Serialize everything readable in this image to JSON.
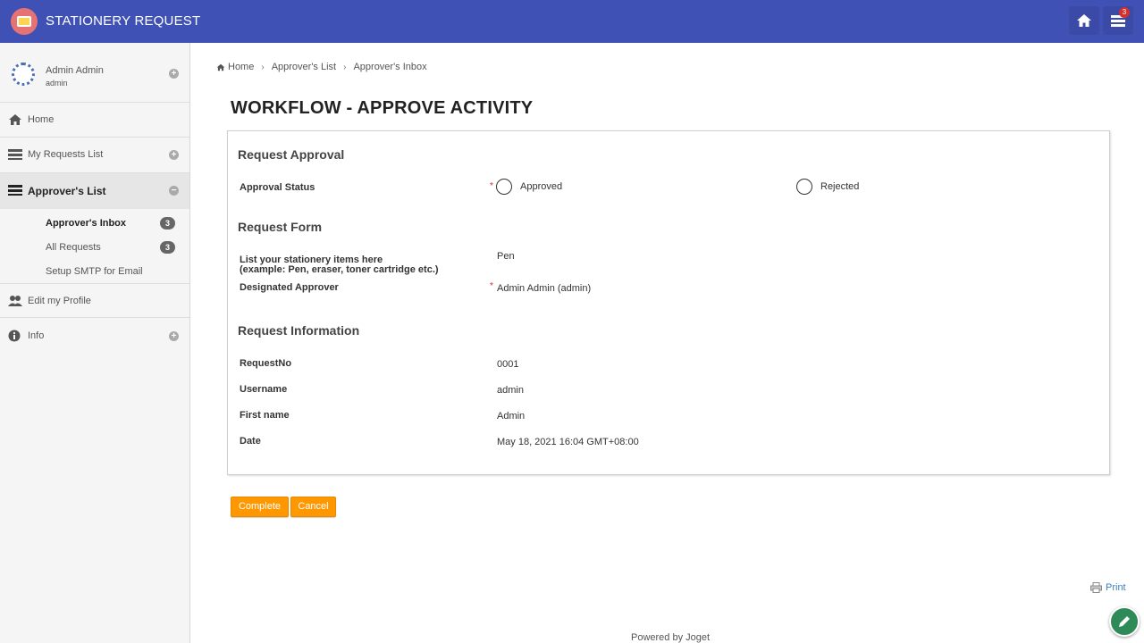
{
  "app": {
    "title": "STATIONERY REQUEST",
    "inbox_count": "3"
  },
  "user": {
    "name": "Admin Admin",
    "id": "admin"
  },
  "sidebar": {
    "items": [
      {
        "label": "Home"
      },
      {
        "label": "My Requests List"
      },
      {
        "label": "Approver's List"
      },
      {
        "label": "Edit my Profile"
      },
      {
        "label": "Info"
      }
    ],
    "subitems": [
      {
        "label": "Approver's Inbox",
        "count": "3"
      },
      {
        "label": "All Requests",
        "count": "3"
      },
      {
        "label": "Setup SMTP for Email"
      }
    ]
  },
  "breadcrumb": [
    "Home",
    "Approver's List",
    "Approver's Inbox"
  ],
  "page_title": "WORKFLOW - APPROVE ACTIVITY",
  "form": {
    "section1": "Request Approval",
    "approval_status_label": "Approval Status",
    "option_approved": "Approved",
    "option_rejected": "Rejected",
    "section2": "Request Form",
    "items_label_line1": "List your stationery items here",
    "items_label_line2": "(example: Pen, eraser, toner cartridge etc.)",
    "items_value": "Pen",
    "approver_label": "Designated Approver",
    "approver_value": "Admin Admin (admin)",
    "section3": "Request Information",
    "info": [
      {
        "label": "RequestNo",
        "value": "0001"
      },
      {
        "label": "Username",
        "value": "admin"
      },
      {
        "label": "First name",
        "value": "Admin"
      },
      {
        "label": "Date",
        "value": "May 18, 2021 16:04 GMT+08:00"
      }
    ],
    "required_mark": "*"
  },
  "buttons": {
    "complete": "Complete",
    "cancel": "Cancel"
  },
  "print_label": "Print",
  "footer": "Powered by Joget",
  "colors": {
    "topbar": "#3f51b5",
    "button": "#ff9800",
    "fab": "#2e8b57"
  }
}
